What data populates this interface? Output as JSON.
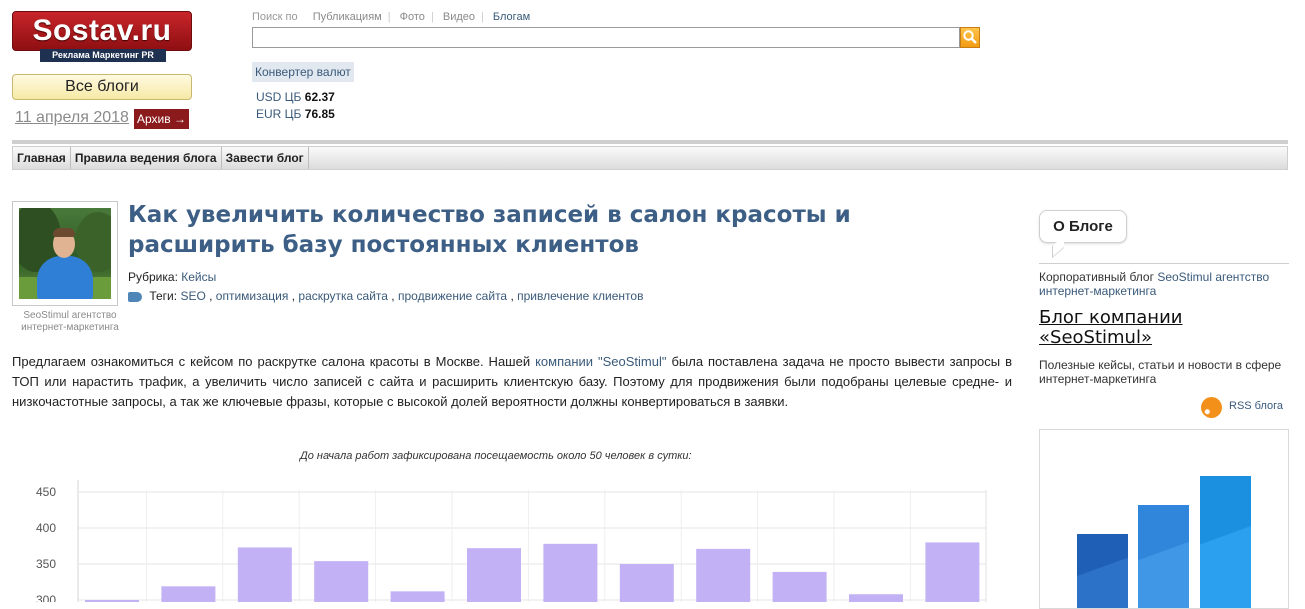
{
  "header": {
    "logo": "Sostav.ru",
    "logo_subtitle": "Реклама Маркетинг PR",
    "all_blogs": "Все блоги",
    "date": "11 апреля 2018",
    "archive": "Архив →",
    "search_label": "Поиск по",
    "search_tabs": [
      "Публикациям",
      "Фото",
      "Видео",
      "Блогам"
    ],
    "search_value": "",
    "converter": "Конвертер валют",
    "rates": [
      {
        "label": "USD ЦБ",
        "value": "62.37"
      },
      {
        "label": "EUR ЦБ",
        "value": "76.85"
      }
    ]
  },
  "menu": [
    "Главная",
    "Правила ведения блога",
    "Завести блог"
  ],
  "article": {
    "author_caption": "SeoStimul агентство интернет-маркетинга",
    "title": "Как увеличить количество записей в салон красоты и расширить базу постоянных клиентов",
    "rubric_label": "Рубрика:",
    "rubric": "Кейсы",
    "tags_label": "Теги:",
    "tags": [
      "SEO",
      "оптимизация",
      "раскрутка сайта",
      "продвижение сайта",
      "привлечение клиентов"
    ],
    "para_before": "Предлагаем ознакомиться с кейсом по раскрутке салона красоты в Москве. Нашей ",
    "para_link": "компании \"SeoStimul\"",
    "para_after": " была поставлена задача не просто вывести запросы в ТОП или нарастить трафик, а увеличить число записей с сайта и расширить клиентскую базу. Поэтому для продвижения были подобраны целевые средне- и низкочастотные запросы, а так же ключевые фразы, которые с высокой долей вероятности должны конвертироваться в заявки.",
    "chart_caption": "До начала работ зафиксирована посещаемость около 50 человек в сутки:"
  },
  "chart_data": {
    "type": "bar",
    "title": "",
    "xlabel": "",
    "ylabel": "",
    "yticks": [
      300,
      350,
      400,
      450
    ],
    "ylim": [
      300,
      460
    ],
    "values": [
      298,
      319,
      373,
      354,
      312,
      372,
      378,
      350,
      371,
      339,
      308,
      380
    ],
    "bar_color": "#c2b1f4"
  },
  "sidebar": {
    "about_tab": "О Блоге",
    "corporate_prefix": "Корпоративный блог ",
    "corporate_link": "SeoStimul агентство интернет-маркетинга",
    "blog_name": "Блог компании «SeoStimul»",
    "blog_desc": "Полезные кейсы, статьи и новости в сфере интернет-маркетинга",
    "rss": "RSS блога"
  }
}
